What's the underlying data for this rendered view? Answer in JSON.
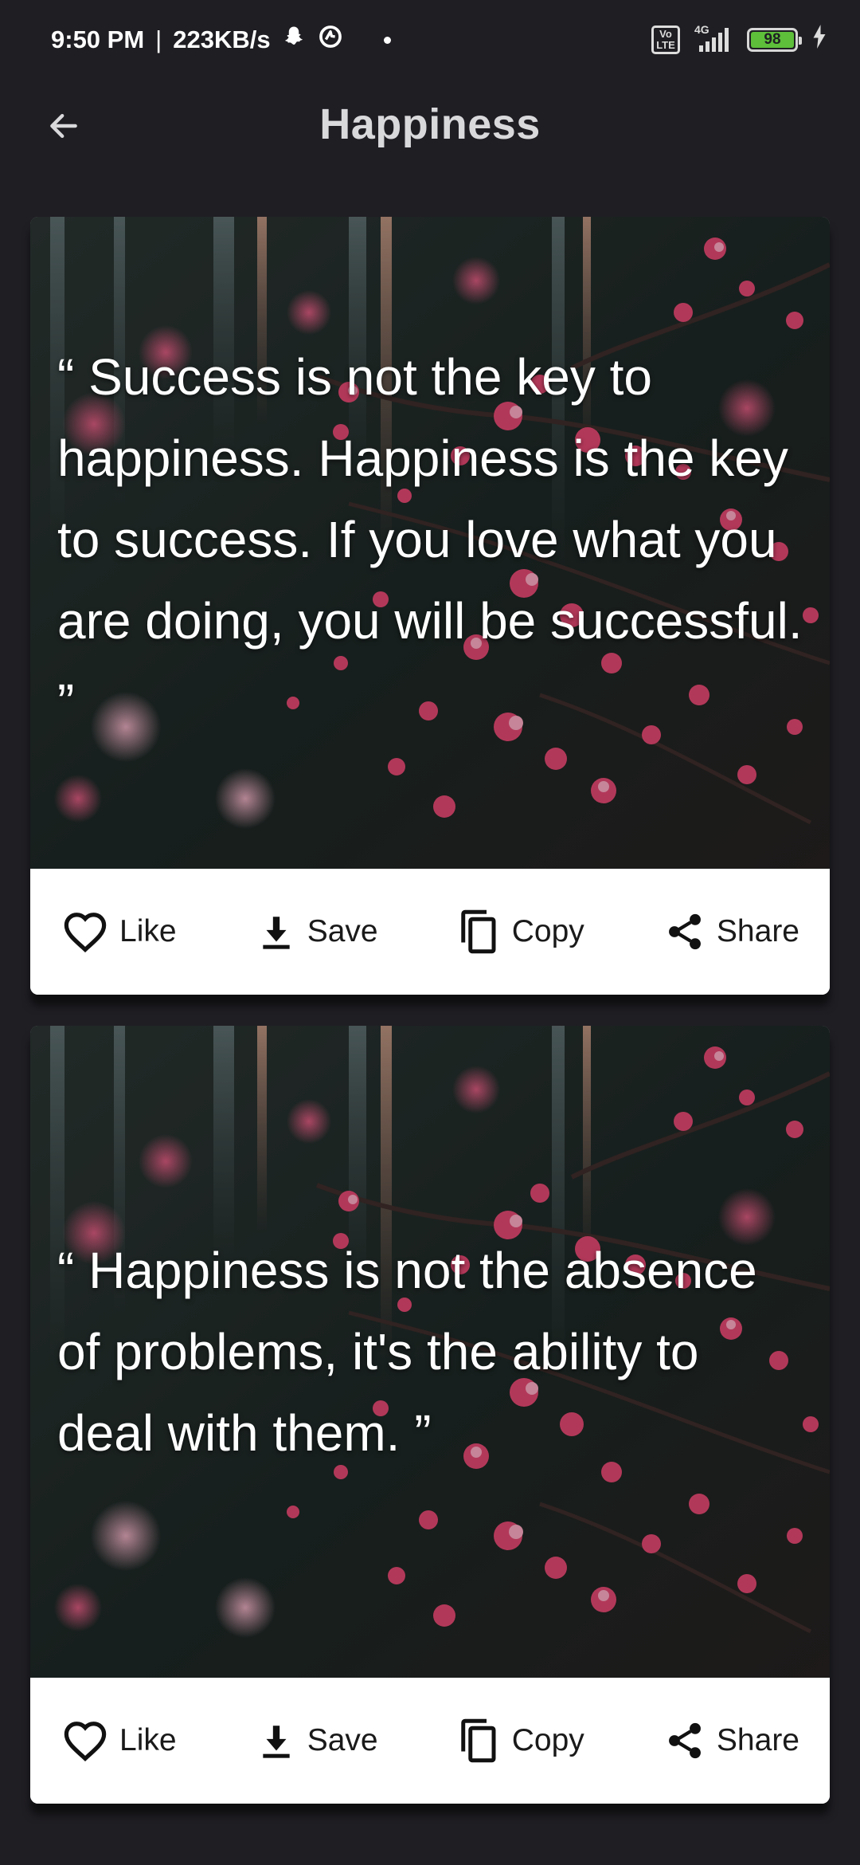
{
  "status_bar": {
    "time": "9:50 PM",
    "network_speed": "223KB/s",
    "volte": "Vo\nLTE",
    "signal": "4G",
    "battery": "98",
    "icons": [
      "snapchat-icon",
      "sync-icon",
      "signal-icon",
      "charging-icon"
    ]
  },
  "app_bar": {
    "title": "Happiness",
    "back_icon": "arrow-left-icon"
  },
  "quotes": [
    {
      "text": "“ Success is not the key to happiness. Happiness is the key to success. If you love what you are doing, you will be successful. ”",
      "actions": {
        "like": "Like",
        "save": "Save",
        "copy": "Copy",
        "share": "Share"
      }
    },
    {
      "text": "“ Happiness is not the absence of problems, it's the ability to deal with them. ”",
      "actions": {
        "like": "Like",
        "save": "Save",
        "copy": "Copy",
        "share": "Share"
      }
    }
  ],
  "colors": {
    "background": "#1f1e23",
    "title": "#d9d9dc",
    "card_actions_bg": "#ffffff",
    "blossom": "#d9456d"
  }
}
